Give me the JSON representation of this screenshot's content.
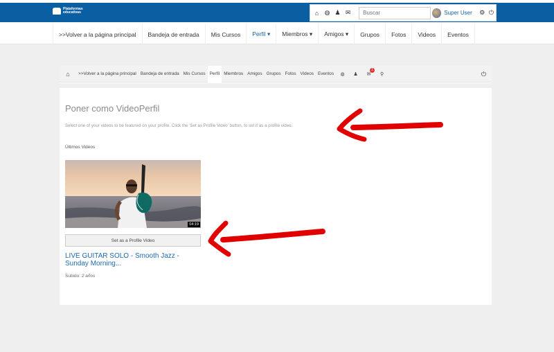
{
  "topbar": {
    "logo_text_line1": "Plataformas",
    "logo_text_line2": "educativas",
    "search_placeholder": "Buscar",
    "user_name": "Super User"
  },
  "main_nav": {
    "items": [
      {
        "label": ">>Volver a la página principal"
      },
      {
        "label": "Bandeja de entrada"
      },
      {
        "label": "Mis Cursos"
      },
      {
        "label": "Perfil ▾"
      },
      {
        "label": "Miembros ▾"
      },
      {
        "label": "Amigos ▾"
      },
      {
        "label": "Grupos"
      },
      {
        "label": "Fotos"
      },
      {
        "label": "Videos"
      },
      {
        "label": "Eventos"
      }
    ]
  },
  "inner_nav": {
    "items": [
      {
        "label": ">>Volver a la página principal"
      },
      {
        "label": "Bandeja de entrada"
      },
      {
        "label": "Mis Cursos"
      },
      {
        "label": "Perfil"
      },
      {
        "label": "Miembros"
      },
      {
        "label": "Amigos"
      },
      {
        "label": "Grupos"
      },
      {
        "label": "Fotos"
      },
      {
        "label": "Videos"
      },
      {
        "label": "Eventos"
      }
    ],
    "notification_count": "1"
  },
  "content": {
    "title": "Poner como VideoPerfil",
    "description": "Select one of your videos to be featured on your profile. Click the 'Set as Profile Video' button, to set it as a profile video.",
    "section_label": "Últimos Videos",
    "video": {
      "duration": "04:19",
      "button_label": "Set as a Profile Video",
      "title": "LIVE GUITAR SOLO - Smooth Jazz - Sunday Morning...",
      "uploaded_label": "Subido:",
      "uploaded_value": "2 años"
    }
  },
  "colors": {
    "brand_blue": "#0a5fa3",
    "link_blue": "#1c6ab0",
    "annotation_red": "#e00000"
  }
}
